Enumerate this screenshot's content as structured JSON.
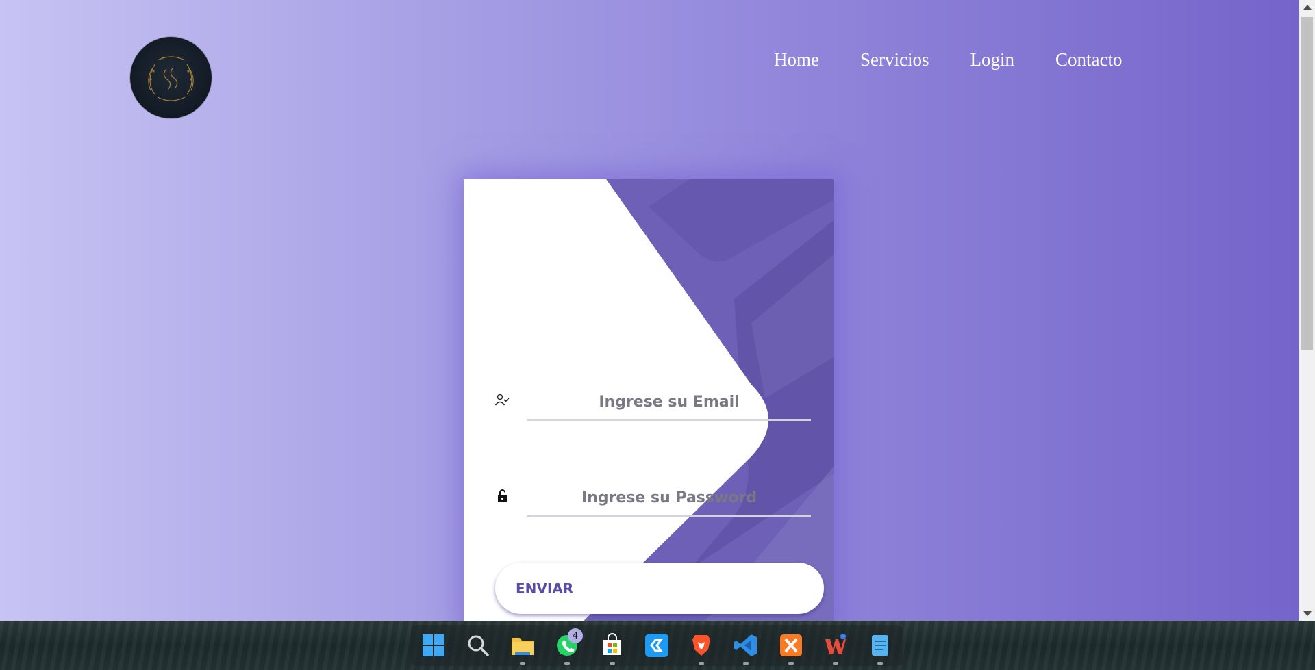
{
  "nav": {
    "items": [
      {
        "label": "Home"
      },
      {
        "label": "Servicios"
      },
      {
        "label": "Login"
      },
      {
        "label": "Contacto"
      }
    ]
  },
  "login": {
    "email_placeholder": "Ingrese su Email",
    "password_placeholder": "Ingrese su Password",
    "submit_label": "ENVIAR"
  },
  "taskbar": {
    "apps": [
      {
        "name": "start-icon",
        "color": "#3fa9f5"
      },
      {
        "name": "search-icon",
        "color": "#d8d8d8"
      },
      {
        "name": "file-explorer-icon",
        "color": "#f4c042"
      },
      {
        "name": "whatsapp-icon",
        "color": "#25d366",
        "badge": "4"
      },
      {
        "name": "microsoft-store-icon",
        "color": "#ffffff"
      },
      {
        "name": "link-app-icon",
        "color": "#1e9bf0"
      },
      {
        "name": "brave-browser-icon",
        "color": "#fb542b"
      },
      {
        "name": "vscode-icon",
        "color": "#2c8ee6"
      },
      {
        "name": "xampp-icon",
        "color": "#fb7a24"
      },
      {
        "name": "wps-office-icon",
        "color": "#e84c3d"
      },
      {
        "name": "notepad-icon",
        "color": "#57b3f0"
      }
    ]
  },
  "colors": {
    "accent": "#6a5cb8",
    "button_text": "#5a4da6"
  }
}
